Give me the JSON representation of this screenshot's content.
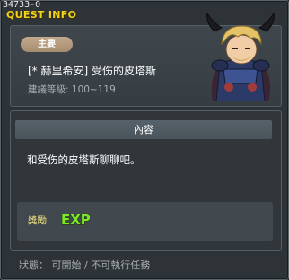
{
  "window": {
    "quest_id": "34733-0",
    "title": "QUEST INFO"
  },
  "quest": {
    "type_badge": "主要",
    "name": "[* 赫里希安] 受伤的皮塔斯",
    "level_label": "建議等級",
    "level_range": "100~119",
    "portrait_icon": "armored-knight-portrait"
  },
  "content": {
    "section_title": "內容",
    "text": "和受伤的皮塔斯聊聊吧。"
  },
  "reward": {
    "label": "獎勵",
    "exp_icon": "exp-icon",
    "exp_text": "EXP"
  },
  "status": {
    "text": "狀態： 可開始 / 不可執行任務"
  },
  "colors": {
    "title": "#f1d21e",
    "badge": "#b79c7f",
    "exp_green": "#7ee62b",
    "background": "#2e3337"
  }
}
